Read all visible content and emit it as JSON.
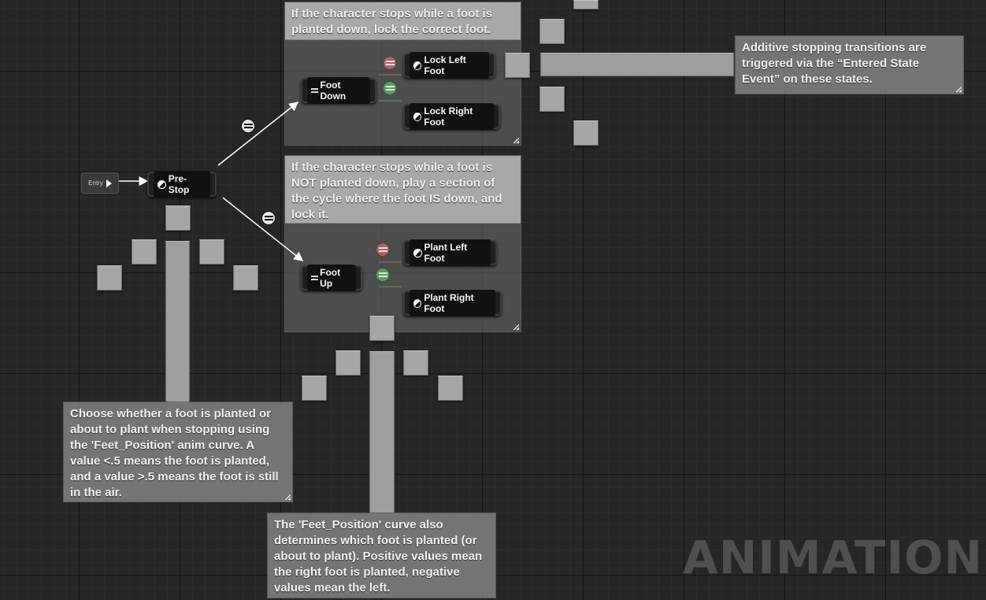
{
  "comments": {
    "top_state": "If the character stops while a foot is\nplanted down, lock the correct foot.",
    "bottom_state": "If the character stops while a foot is\nNOT planted down, play a section of\nthe cycle where the foot IS down, and\nlock it.",
    "additive": "Additive stopping transitions are\ntriggered via the “Entered State\nEvent” on these states.",
    "feet_position_planted": "Choose whether a foot is planted or\nabout to plant when stopping using\nthe 'Feet_Position' anim curve. A\nvalue <.5 means the foot is planted,\nand a value >.5 means the foot is still\nin the air.",
    "feet_position_which": "The 'Feet_Position' curve also\ndetermines which foot is planted (or\nabout to plant). Positive values mean\nthe right foot is planted, negative\nvalues mean the left."
  },
  "nodes": {
    "entry": "Entry",
    "pre_stop": "Pre-Stop",
    "foot_down": "Foot Down",
    "lock_left_foot": "Lock Left Foot",
    "lock_right_foot": "Lock Right Foot",
    "foot_up": "Foot Up",
    "plant_left_foot": "Plant Left Foot",
    "plant_right_foot": "Plant Right Foot"
  },
  "watermark": "ANIMATION",
  "colors": {
    "background": "#262626",
    "comment_fill": "#8a8a8a",
    "transition_red": "#a66666",
    "transition_green": "#5e9a63",
    "wire_white": "#ffffff"
  }
}
